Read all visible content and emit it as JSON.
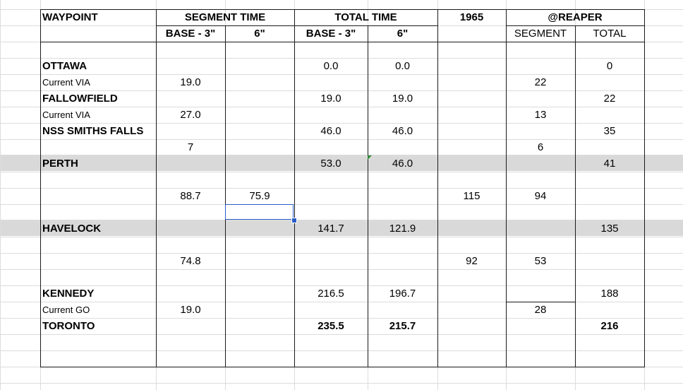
{
  "headers": {
    "waypoint": "WAYPOINT",
    "segment_time": "SEGMENT TIME",
    "total_time": "TOTAL TIME",
    "year": "1965",
    "reaper": "@REAPER",
    "seg_base": "BASE - 3\"",
    "seg_6": "6\"",
    "tot_base": "BASE - 3\"",
    "tot_6": "6\"",
    "reaper_segment": "SEGMENT",
    "reaper_total": "TOTAL"
  },
  "rows": [
    {
      "waypoint": "OTTAWA",
      "bold": true,
      "seg_base": "",
      "seg_6": "",
      "tot_base": "0.0",
      "tot_6": "0.0",
      "y1965": "",
      "r_seg": "",
      "r_tot": "0",
      "shaded": false
    },
    {
      "waypoint": "Current VIA",
      "bold": false,
      "seg_base": "19.0",
      "seg_6": "",
      "tot_base": "",
      "tot_6": "",
      "y1965": "",
      "r_seg": "22",
      "r_tot": "",
      "shaded": false
    },
    {
      "waypoint": "FALLOWFIELD",
      "bold": true,
      "seg_base": "",
      "seg_6": "",
      "tot_base": "19.0",
      "tot_6": "19.0",
      "y1965": "",
      "r_seg": "",
      "r_tot": "22",
      "shaded": false
    },
    {
      "waypoint": "Current VIA",
      "bold": false,
      "seg_base": "27.0",
      "seg_6": "",
      "tot_base": "",
      "tot_6": "",
      "y1965": "",
      "r_seg": "13",
      "r_tot": "",
      "shaded": false
    },
    {
      "waypoint": "NSS SMITHS FALLS",
      "bold": true,
      "seg_base": "",
      "seg_6": "",
      "tot_base": "46.0",
      "tot_6": "46.0",
      "y1965": "",
      "r_seg": "",
      "r_tot": "35",
      "shaded": false
    },
    {
      "waypoint": "",
      "bold": false,
      "seg_base": "7",
      "seg_6": "",
      "tot_base": "",
      "tot_6": "",
      "y1965": "",
      "r_seg": "6",
      "r_tot": "",
      "shaded": false
    },
    {
      "waypoint": "PERTH",
      "bold": true,
      "seg_base": "",
      "seg_6": "",
      "tot_base": "53.0",
      "tot_6": "46.0",
      "y1965": "",
      "r_seg": "",
      "r_tot": "41",
      "shaded": true
    },
    {
      "waypoint": "",
      "bold": false,
      "seg_base": "",
      "seg_6": "",
      "tot_base": "",
      "tot_6": "",
      "y1965": "",
      "r_seg": "",
      "r_tot": "",
      "shaded": false
    },
    {
      "waypoint": "",
      "bold": false,
      "seg_base": "88.7",
      "seg_6": "75.9",
      "tot_base": "",
      "tot_6": "",
      "y1965": "115",
      "r_seg": "94",
      "r_tot": "",
      "shaded": false
    },
    {
      "waypoint": "",
      "bold": false,
      "seg_base": "",
      "seg_6": "",
      "tot_base": "",
      "tot_6": "",
      "y1965": "",
      "r_seg": "",
      "r_tot": "",
      "shaded": false
    },
    {
      "waypoint": "HAVELOCK",
      "bold": true,
      "seg_base": "",
      "seg_6": "",
      "tot_base": "141.7",
      "tot_6": "121.9",
      "y1965": "",
      "r_seg": "",
      "r_tot": "135",
      "shaded": true
    },
    {
      "waypoint": "",
      "bold": false,
      "seg_base": "",
      "seg_6": "",
      "tot_base": "",
      "tot_6": "",
      "y1965": "",
      "r_seg": "",
      "r_tot": "",
      "shaded": false
    },
    {
      "waypoint": "",
      "bold": false,
      "seg_base": "74.8",
      "seg_6": "",
      "tot_base": "",
      "tot_6": "",
      "y1965": "92",
      "r_seg": "53",
      "r_tot": "",
      "shaded": false
    },
    {
      "waypoint": "",
      "bold": false,
      "seg_base": "",
      "seg_6": "",
      "tot_base": "",
      "tot_6": "",
      "y1965": "",
      "r_seg": "",
      "r_tot": "",
      "shaded": false
    },
    {
      "waypoint": "KENNEDY",
      "bold": true,
      "seg_base": "",
      "seg_6": "",
      "tot_base": "216.5",
      "tot_6": "196.7",
      "y1965": "",
      "r_seg": "",
      "r_tot": "188",
      "shaded": false
    },
    {
      "waypoint": "Current GO",
      "bold": false,
      "seg_base": "19.0",
      "seg_6": "",
      "tot_base": "",
      "tot_6": "",
      "y1965": "",
      "r_seg": "28",
      "r_tot": "",
      "shaded": false
    },
    {
      "waypoint": "TORONTO",
      "bold": true,
      "seg_base": "",
      "seg_6": "",
      "tot_base": "235.5",
      "tot_6": "215.7",
      "y1965": "",
      "r_seg": "",
      "r_tot": "216",
      "shaded": false,
      "totals_bold": true
    }
  ]
}
